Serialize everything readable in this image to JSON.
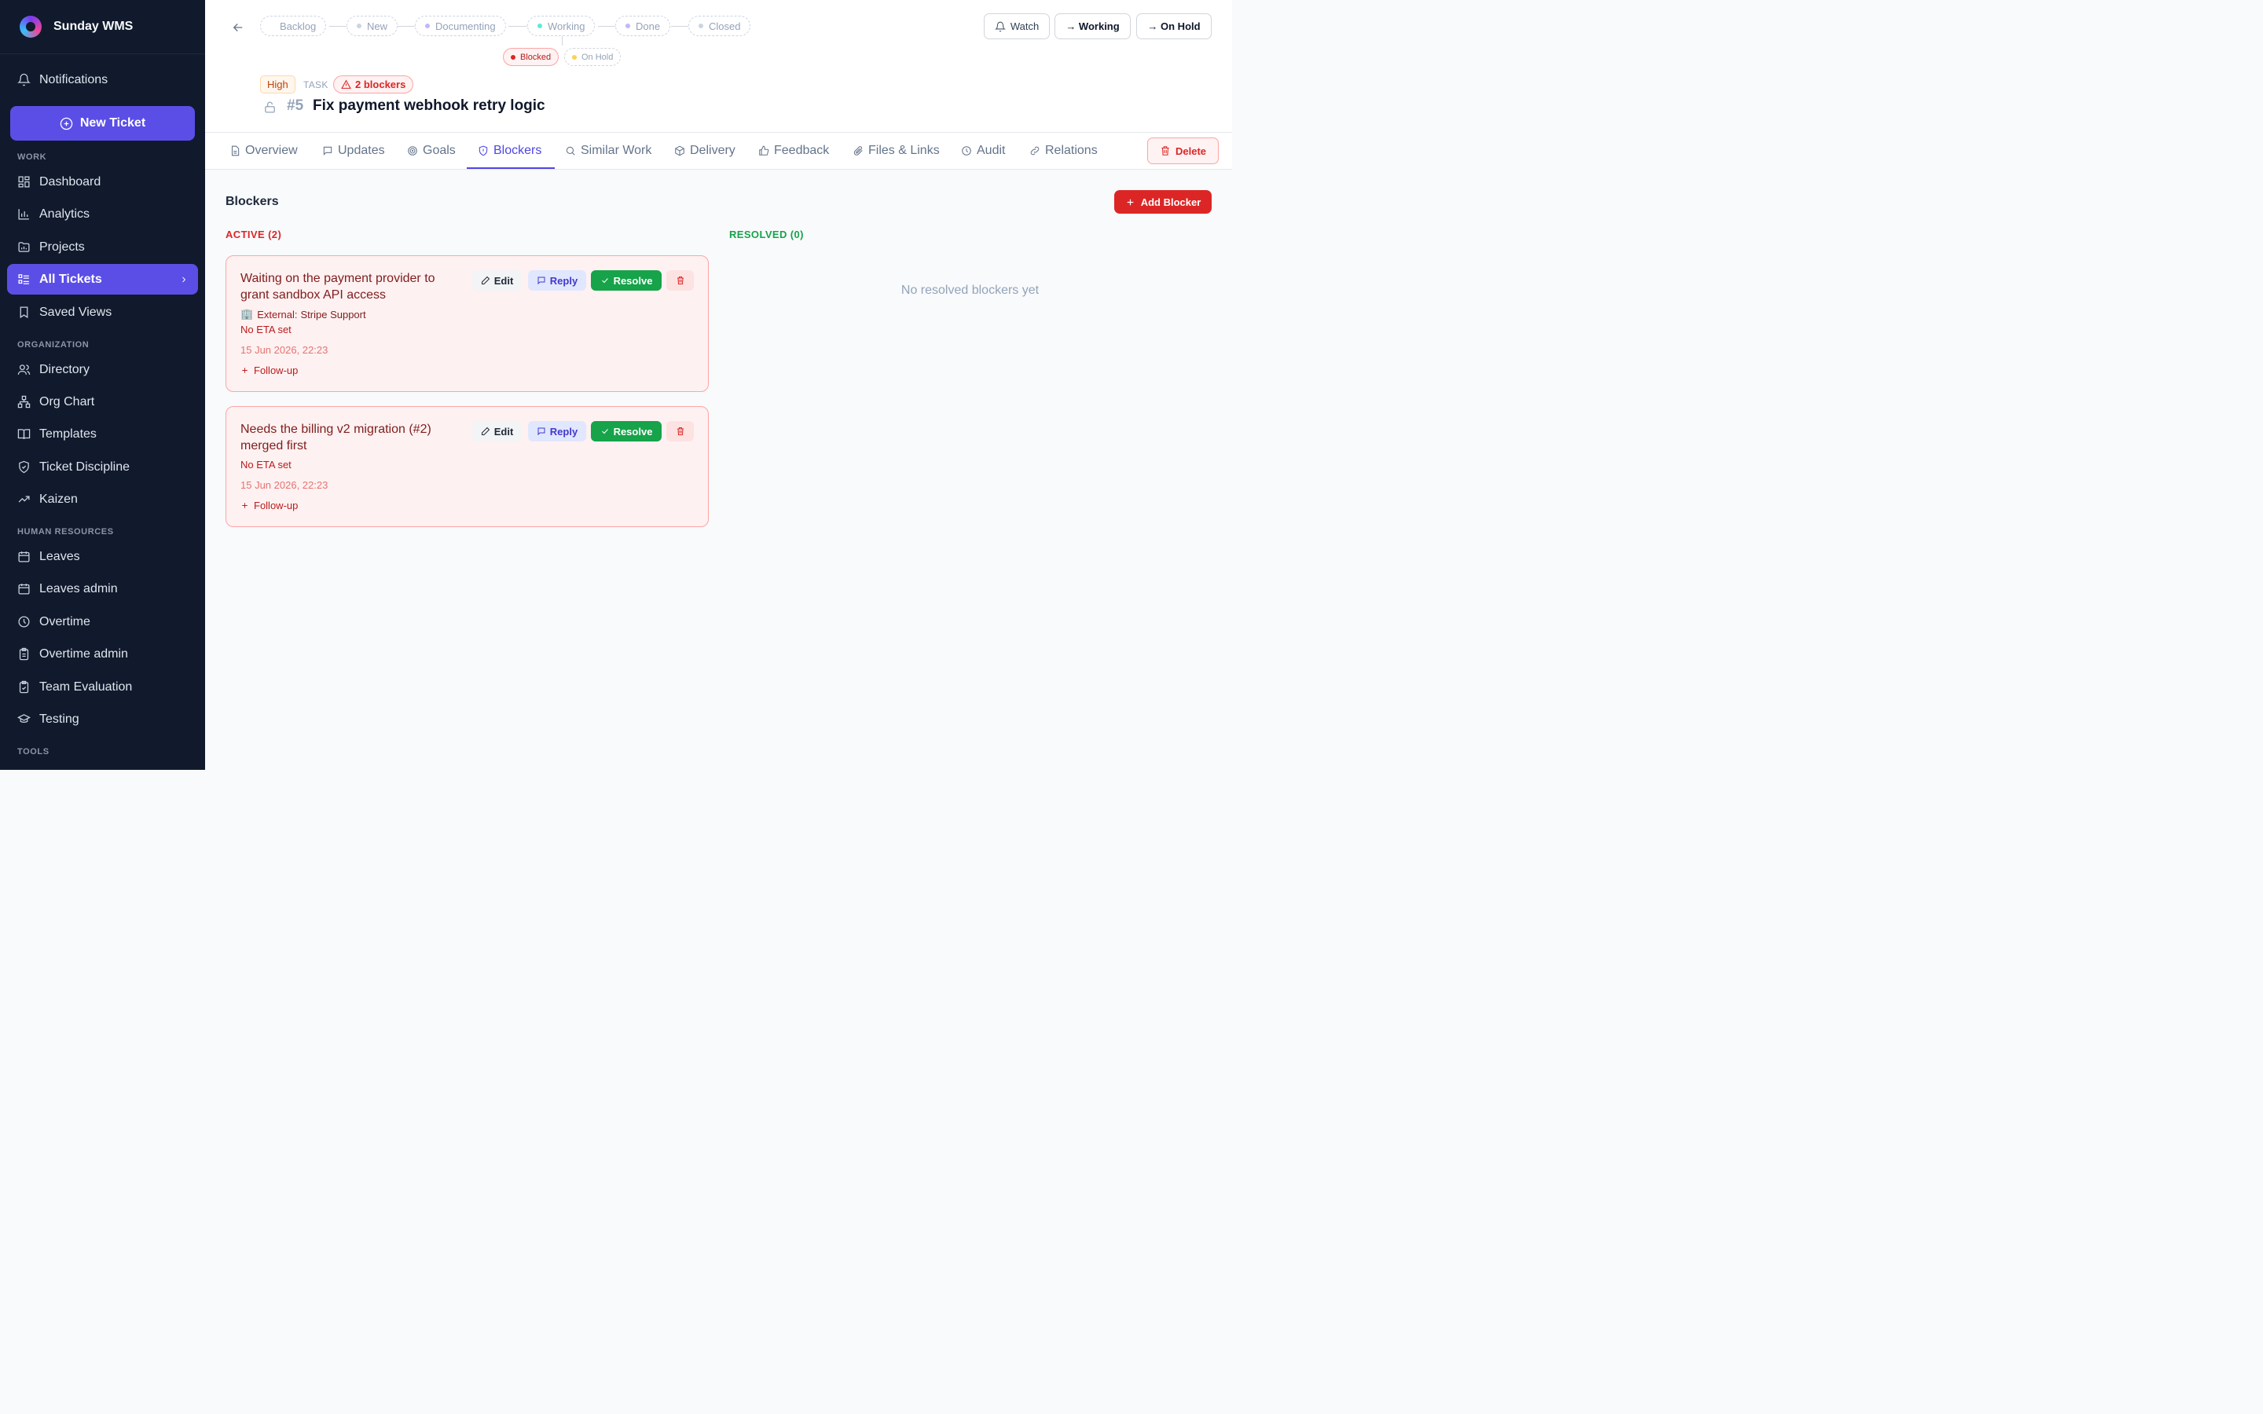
{
  "app": {
    "name": "Sunday WMS"
  },
  "sidebar": {
    "notifications": "Notifications",
    "new_ticket": "New Ticket",
    "sections": {
      "work": "WORK",
      "organization": "ORGANIZATION",
      "human_resources": "HUMAN RESOURCES",
      "tools": "TOOLS"
    },
    "work_items": [
      "Dashboard",
      "Analytics",
      "Projects",
      "All Tickets",
      "Saved Views"
    ],
    "org_items": [
      "Directory",
      "Org Chart",
      "Templates",
      "Ticket Discipline",
      "Kaizen"
    ],
    "hr_items": [
      "Leaves",
      "Leaves admin",
      "Overtime",
      "Overtime admin",
      "Team Evaluation",
      "Testing"
    ],
    "active_item": "All Tickets"
  },
  "workflow": {
    "stages": [
      {
        "label": "Backlog",
        "color": ""
      },
      {
        "label": "New",
        "color": "#cbd5e1"
      },
      {
        "label": "Documenting",
        "color": "#c4b5fd"
      },
      {
        "label": "Working",
        "color": "#5eead4"
      },
      {
        "label": "Done",
        "color": "#c4b5fd"
      },
      {
        "label": "Closed",
        "color": "#cbd5e1"
      }
    ],
    "side_states": [
      {
        "label": "Blocked",
        "color": "#dc2626"
      },
      {
        "label": "On Hold",
        "color": "#fcd34d"
      }
    ]
  },
  "header_actions": {
    "watch": "Watch",
    "to_working": "→ Working",
    "to_on_hold": "→ On Hold"
  },
  "ticket": {
    "priority": "High",
    "type": "TASK",
    "blockers_badge": "2 blockers",
    "number": "#5",
    "title": "Fix payment webhook retry logic"
  },
  "tabs": [
    "Overview",
    "Updates",
    "Goals",
    "Blockers",
    "Similar Work",
    "Delivery",
    "Feedback",
    "Files & Links",
    "Audit",
    "Relations"
  ],
  "active_tab": "Blockers",
  "delete_label": "Delete",
  "blockers": {
    "title": "Blockers",
    "add_label": "Add Blocker",
    "active_label": "ACTIVE (2)",
    "resolved_label": "RESOLVED (0)",
    "resolved_empty": "No resolved blockers yet",
    "action_labels": {
      "edit": "Edit",
      "reply": "Reply",
      "resolve": "Resolve",
      "follow_up": "Follow-up"
    },
    "items": [
      {
        "title": "Waiting on the payment provider to grant sandbox API access",
        "external_prefix": "External:",
        "external_name": "Stripe Support",
        "eta": "No ETA set",
        "date": "15 Jun 2026, 22:23"
      },
      {
        "title": "Needs the billing v2 migration (#2) merged first",
        "eta": "No ETA set",
        "date": "15 Jun 2026, 22:23"
      }
    ]
  },
  "colors": {
    "brand": "#5b4ee6",
    "sidebar_bg": "#101a2c",
    "danger": "#dc2626",
    "success": "#16a34a"
  }
}
